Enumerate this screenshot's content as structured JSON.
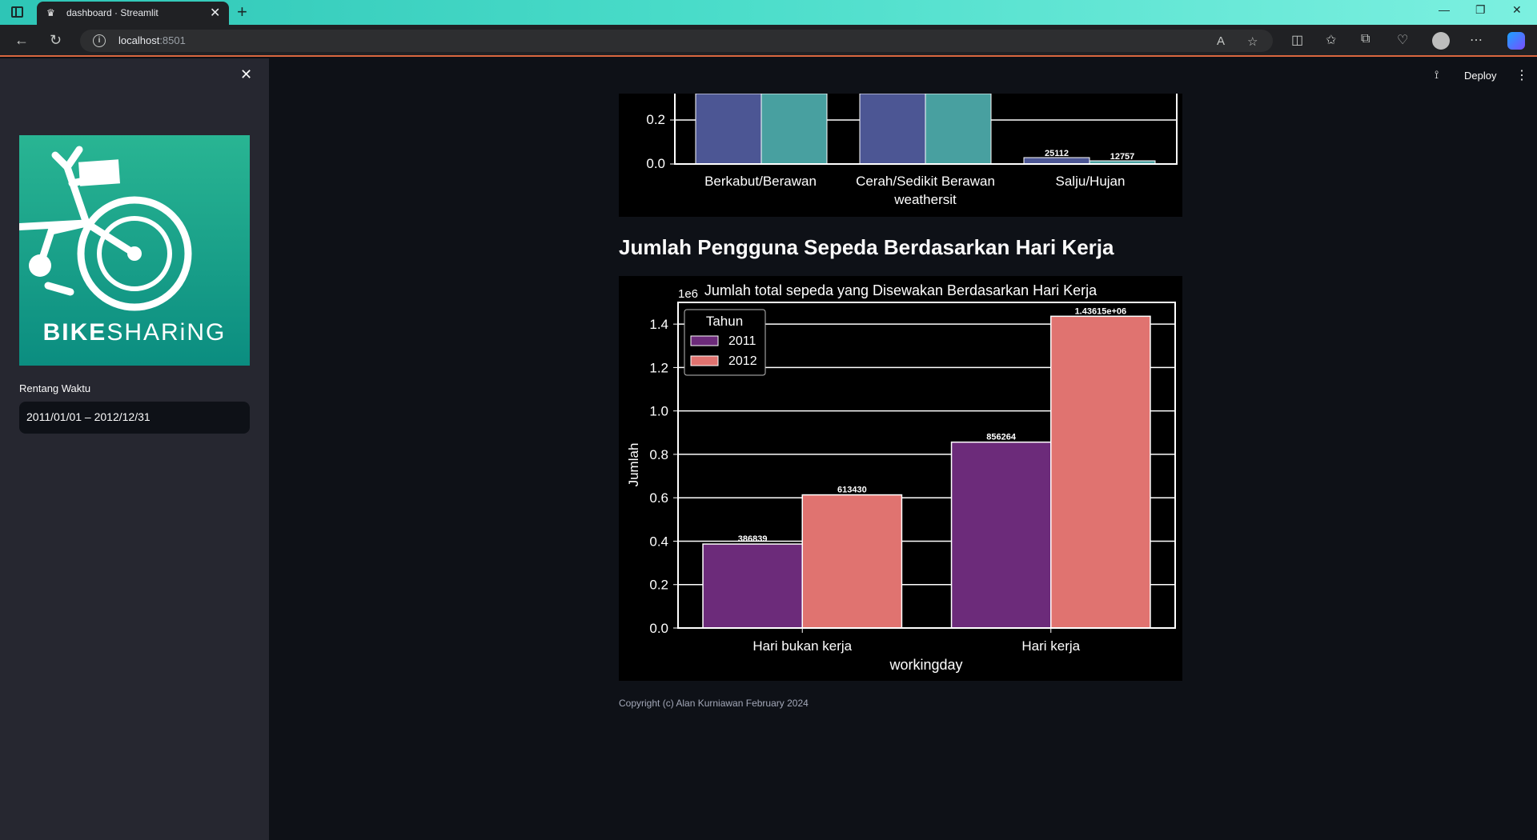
{
  "browser": {
    "tab_title": "dashboard · Streamlit",
    "url_host": "localhost",
    "url_port": ":8501"
  },
  "header": {
    "deploy_label": "Deploy"
  },
  "sidebar": {
    "logo_text_bold": "BIKE",
    "logo_text_light": "SHARiNG",
    "date_label": "Rentang Waktu",
    "date_value": "2011/01/01 – 2012/12/31"
  },
  "main": {
    "section_title": "Jumlah Pengguna Sepeda Berdasarkan Hari Kerja",
    "copyright": "Copyright (c) Alan Kurniawan February 2024"
  },
  "chart_data": [
    {
      "type": "bar",
      "title": "",
      "xlabel": "weathersit",
      "ylabel": "",
      "categories": [
        "Berkabut/Berawan",
        "Cerah/Sedikit Berawan",
        "Salju/Hujan"
      ],
      "series": [
        {
          "values": [
            null,
            null,
            25112
          ],
          "color": "#4c5694"
        },
        {
          "values": [
            null,
            null,
            12757
          ],
          "color": "#48a0a0"
        }
      ],
      "y_ticks": [
        "0.0",
        "0.2"
      ],
      "data_labels": [
        "25112",
        "12757"
      ],
      "scale_label": "",
      "note": "upper part of chart scrolled out of view"
    },
    {
      "type": "bar",
      "title": "Jumlah total sepeda yang Disewakan Berdasarkan Hari Kerja",
      "xlabel": "workingday",
      "ylabel": "Jumlah",
      "scale_label": "1e6",
      "categories": [
        "Hari bukan kerja",
        "Hari kerja"
      ],
      "ylim": [
        0,
        1.5
      ],
      "y_ticks": [
        "0.0",
        "0.2",
        "0.4",
        "0.6",
        "0.8",
        "1.0",
        "1.2",
        "1.4"
      ],
      "legend_title": "Tahun",
      "legend_placement": "top-left",
      "grid": true,
      "series": [
        {
          "name": "2011",
          "values": [
            386839,
            856264
          ],
          "labels": [
            "386839",
            "856264"
          ],
          "color": "#6c2b7a"
        },
        {
          "name": "2012",
          "values": [
            613430,
            1436150
          ],
          "labels": [
            "613430",
            "1.43615e+06"
          ],
          "color": "#e07370"
        }
      ]
    }
  ]
}
